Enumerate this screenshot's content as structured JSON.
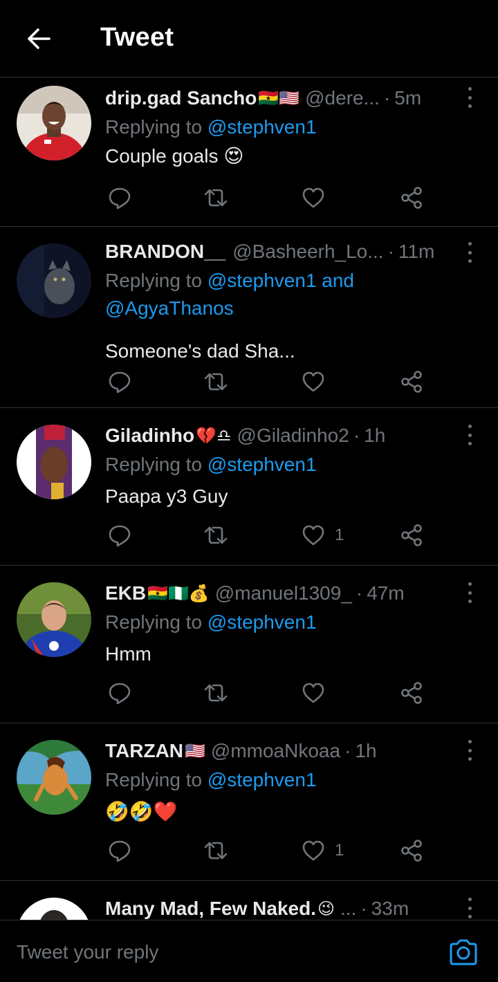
{
  "header": {
    "title": "Tweet"
  },
  "tweets": [
    {
      "name": "drip.gad Sancho",
      "name_emoji": "🇬🇭🇺🇸",
      "handle": "@dere...",
      "time": "5m",
      "replying_prefix": "Replying to",
      "mentions_line1": "@stephven1",
      "mentions_line2": "",
      "text": "Couple goals 😍",
      "like_count": ""
    },
    {
      "name": "BRANDON__",
      "name_emoji": "",
      "handle": "@Basheerh_Lo...",
      "time": "11m",
      "replying_prefix": "Replying to",
      "mentions_line1": "@stephven1 and",
      "mentions_line2": "@AgyaThanos",
      "text": "Someone's dad Sha...",
      "like_count": ""
    },
    {
      "name": "Giladinho",
      "name_emoji": "💔♎",
      "handle": "@Giladinho2",
      "time": "1h",
      "replying_prefix": "Replying to",
      "mentions_line1": "@stephven1",
      "mentions_line2": "",
      "text": "Paapa y3 Guy",
      "like_count": "1"
    },
    {
      "name": "EKB",
      "name_emoji": "🇬🇭🇳🇬💰",
      "handle": "@manuel1309_",
      "time": "47m",
      "replying_prefix": "Replying to",
      "mentions_line1": "@stephven1",
      "mentions_line2": "",
      "text": "Hmm",
      "like_count": ""
    },
    {
      "name": "TARZAN",
      "name_emoji": "🇺🇸",
      "handle": "@mmoaNkoaa",
      "time": "1h",
      "replying_prefix": "Replying to",
      "mentions_line1": "@stephven1",
      "mentions_line2": "",
      "text": "🤣🤣❤️",
      "like_count": "1"
    },
    {
      "name": "Many Mad, Few Naked.",
      "name_emoji": "😉",
      "handle": "...",
      "time": "33m",
      "replying_prefix": "",
      "mentions_line1": "",
      "mentions_line2": "",
      "text": "",
      "like_count": ""
    }
  ],
  "reply_bar": {
    "placeholder": "Tweet your reply"
  },
  "colors": {
    "background": "#000000",
    "text_primary": "#e7e9ea",
    "text_secondary": "#71767b",
    "accent": "#1d9bf0",
    "divider": "#2f3336"
  },
  "icons": {
    "back": "arrow-left-icon",
    "reply": "reply-icon",
    "retweet": "retweet-icon",
    "like": "heart-icon",
    "share": "share-icon",
    "more": "more-vertical-icon",
    "camera": "camera-icon"
  }
}
